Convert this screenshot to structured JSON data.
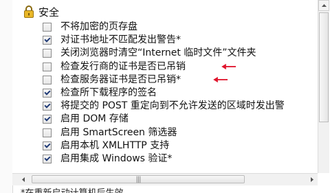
{
  "section": {
    "title": "安全",
    "icon": "lock-icon"
  },
  "items": [
    {
      "label": "不将加密的页存盘",
      "checked": false
    },
    {
      "label": "对证书地址不匹配发出警告*",
      "checked": true
    },
    {
      "label": "关闭浏览器时清空“Internet 临时文件”文件夹",
      "checked": false
    },
    {
      "label": "检查发行商的证书是否已吊销",
      "checked": false
    },
    {
      "label": "检查服务器证书是否已吊销*",
      "checked": false
    },
    {
      "label": "检查所下载程序的签名",
      "checked": true
    },
    {
      "label": "将提交的 POST 重定向到不允许发送的区域时发出警",
      "checked": true
    },
    {
      "label": "启用 DOM 存储",
      "checked": true
    },
    {
      "label": "启用 SmartScreen 筛选器",
      "checked": false
    },
    {
      "label": "启用本机 XMLHTTP 支持",
      "checked": true
    },
    {
      "label": "启用集成 Windows 验证*",
      "checked": true
    }
  ],
  "annotations": {
    "arrow_color": "#e0152d"
  },
  "footer": {
    "partial_text": "*在重新启动计算机后生效"
  }
}
